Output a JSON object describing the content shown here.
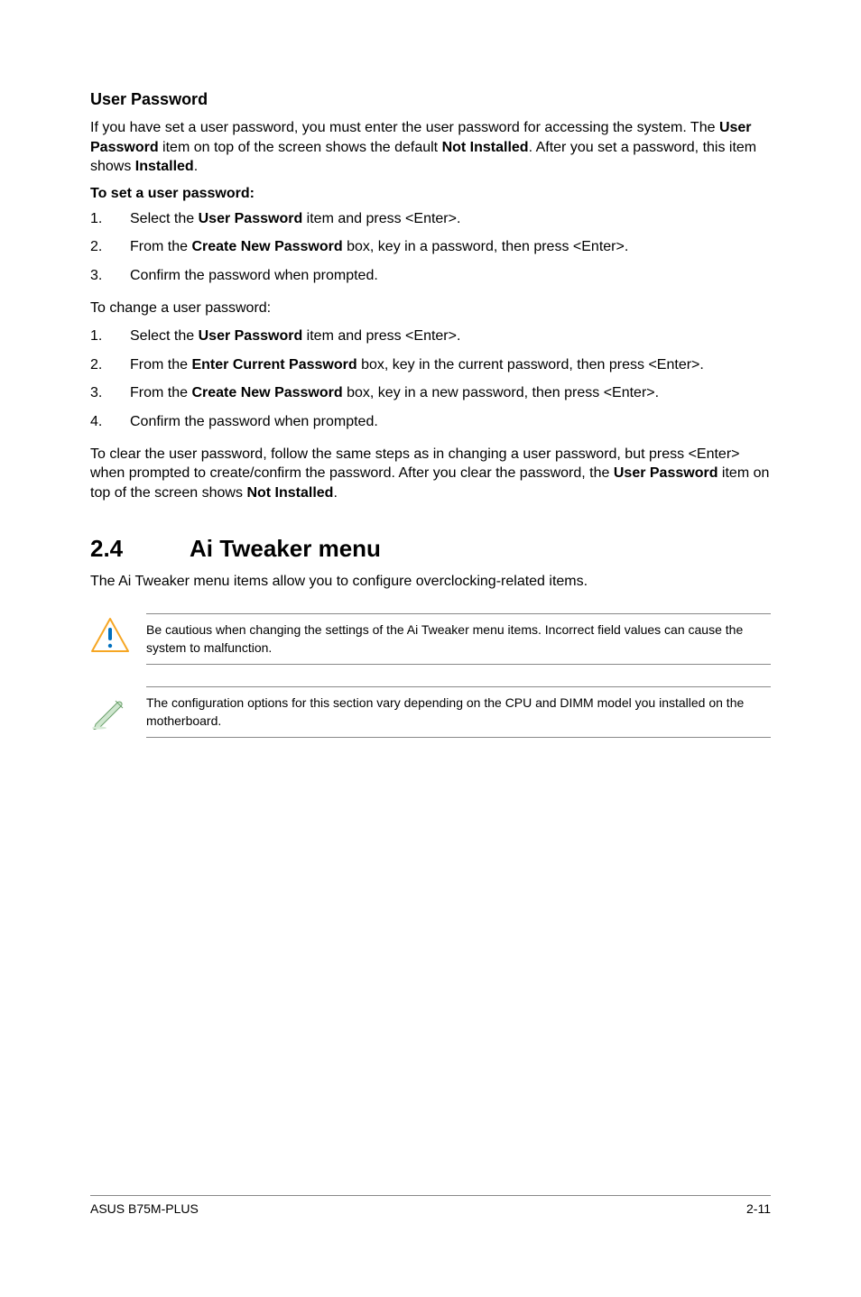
{
  "user_password": {
    "heading": "User Password",
    "intro_1": "If you have set a user password, you must enter the user password for accessing the system. The ",
    "intro_b1": "User Password",
    "intro_2": " item on top of the screen shows the default ",
    "intro_b2": "Not Installed",
    "intro_3": ". After you set a password, this item shows ",
    "intro_b3": "Installed",
    "intro_4": ".",
    "set_heading": "To set a user password:",
    "set_steps": [
      {
        "n": "1.",
        "pre": "Select the ",
        "b": "User Password",
        "post": " item and press <Enter>."
      },
      {
        "n": "2.",
        "pre": "From the ",
        "b": "Create New Password",
        "post": " box, key in a password, then press <Enter>."
      },
      {
        "n": "3.",
        "pre": "Confirm the password when prompted.",
        "b": "",
        "post": ""
      }
    ],
    "change_heading": "To change a user password:",
    "change_steps": [
      {
        "n": "1.",
        "pre": "Select the ",
        "b": "User Password",
        "post": " item and press <Enter>."
      },
      {
        "n": "2.",
        "pre": "From the ",
        "b": "Enter Current Password",
        "post": " box, key in the current password, then press <Enter>."
      },
      {
        "n": "3.",
        "pre": "From the ",
        "b": "Create New Password",
        "post": " box, key in a new password, then press <Enter>."
      },
      {
        "n": "4.",
        "pre": "Confirm the password when prompted.",
        "b": "",
        "post": ""
      }
    ],
    "clear_1": "To clear the user password, follow the same steps as in changing a user password, but press <Enter> when prompted to create/confirm the password. After you clear the password, the ",
    "clear_b1": "User Password",
    "clear_2": " item on top of the screen shows ",
    "clear_b2": "Not Installed",
    "clear_3": "."
  },
  "section": {
    "num": "2.4",
    "title": "Ai Tweaker menu",
    "intro": "The Ai Tweaker menu items allow you to configure overclocking-related items.",
    "note_caution": "Be cautious when changing the settings of the Ai Tweaker menu items. Incorrect field values can cause the system to malfunction.",
    "note_info": "The configuration options for this section vary depending on the CPU and DIMM model you installed on the motherboard."
  },
  "footer": {
    "left": "ASUS B75M-PLUS",
    "right": "2-11"
  }
}
